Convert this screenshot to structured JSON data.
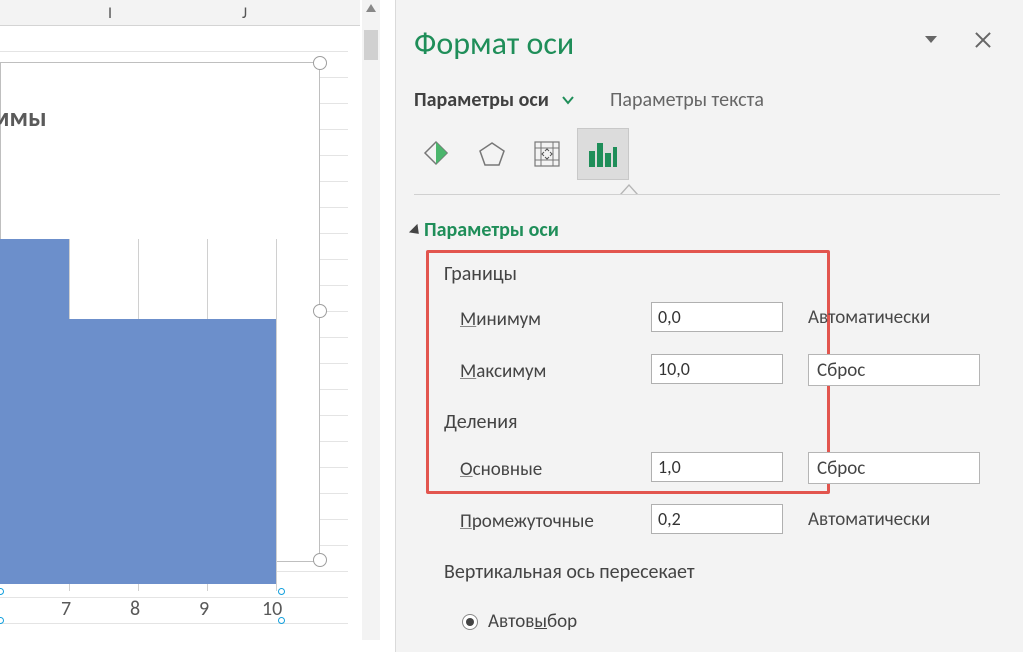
{
  "columns": {
    "I": "I",
    "J": "J"
  },
  "chart_title_fragment": "ммы",
  "xticks": [
    "7",
    "8",
    "9",
    "10"
  ],
  "pane": {
    "title": "Формат оси",
    "tab_axis": "Параметры оси",
    "tab_text": "Параметры текста",
    "section": "Параметры оси",
    "group_bounds": "Границы",
    "min_label_u": "М",
    "min_label_rest": "инимум",
    "max_label_u": "М",
    "max_label_rest": "аксимум",
    "group_units": "Деления",
    "major_label_u": "О",
    "major_label_rest": "сновные",
    "minor_label_u": "П",
    "minor_label_rest": "ромежуточные",
    "min_value": "0,0",
    "max_value": "10,0",
    "major_value": "1,0",
    "minor_value": "0,2",
    "auto_text": "Автоматически",
    "reset_text": "Сброс",
    "crosses_label": "Вертикальная ось пересекает",
    "auto_select_u": "ы",
    "auto_select_pre": "Автов",
    "auto_select_post": "бор"
  },
  "chart_data": {
    "type": "bar",
    "title": "(partial) …ммы",
    "orientation": "horizontal",
    "x": [
      7,
      8,
      9,
      10
    ],
    "note": "Only rightmost fragment of chart visible; bar extents not fully shown."
  }
}
